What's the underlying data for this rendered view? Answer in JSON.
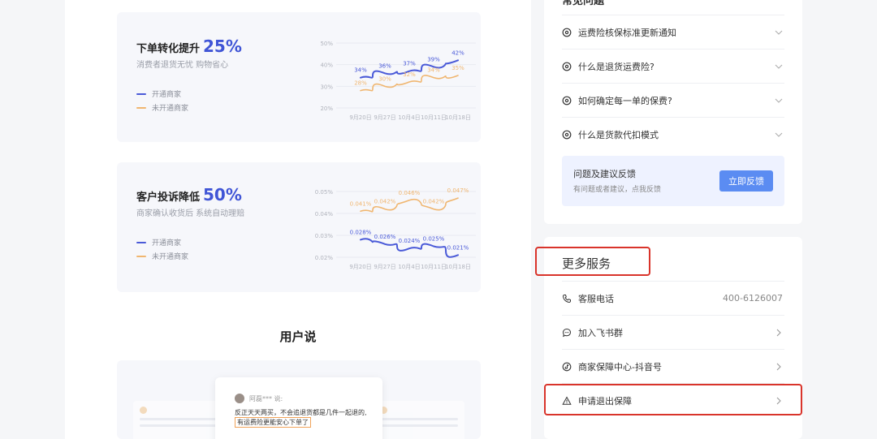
{
  "charts": [
    {
      "title": "下单转化提升",
      "pct": "25%",
      "subtitle": "消费者退货无忧 购物省心",
      "legend": [
        {
          "label": "开通商家",
          "color": "#4a5ad8"
        },
        {
          "label": "未开通商家",
          "color": "#f0b670"
        }
      ]
    },
    {
      "title": "客户投诉降低",
      "pct": "50%",
      "subtitle": "商家确认收货后 系统自动理赔",
      "legend": [
        {
          "label": "开通商家",
          "color": "#4a5ad8"
        },
        {
          "label": "未开通商家",
          "color": "#f0b670"
        }
      ]
    }
  ],
  "chart_data": [
    {
      "type": "line",
      "title": "下单转化提升 25%",
      "categories": [
        "9月20日",
        "9月27日",
        "10月4日",
        "10月11日",
        "10月18日"
      ],
      "yticks": [
        "50%",
        "40%",
        "30%",
        "20%"
      ],
      "ylim": [
        20,
        50
      ],
      "series": [
        {
          "name": "开通商家",
          "values": [
            34,
            36,
            37,
            39,
            42
          ],
          "labels": [
            "34%",
            "36%",
            "37%",
            "39%",
            "42%"
          ],
          "color": "#4a5ad8"
        },
        {
          "name": "未开通商家",
          "values": [
            28,
            30,
            32,
            34,
            35
          ],
          "labels": [
            "28%",
            "30%",
            "32%",
            "34%",
            "35%"
          ],
          "color": "#f0b670"
        }
      ]
    },
    {
      "type": "line",
      "title": "客户投诉降低 50%",
      "categories": [
        "9月20日",
        "9月27日",
        "10月4日",
        "10月11日",
        "10月18日"
      ],
      "yticks": [
        "0.05%",
        "0.04%",
        "0.03%",
        "0.02%"
      ],
      "ylim": [
        0.02,
        0.05
      ],
      "series": [
        {
          "name": "开通商家",
          "values": [
            0.028,
            0.026,
            0.024,
            0.025,
            0.021
          ],
          "labels": [
            "0.028%",
            "0.026%",
            "0.024%",
            "0.025%",
            "0.021%"
          ],
          "color": "#4a5ad8"
        },
        {
          "name": "未开通商家",
          "values": [
            0.041,
            0.042,
            0.046,
            0.042,
            0.047
          ],
          "labels": [
            "0.041%",
            "0.042%",
            "0.046%",
            "0.042%",
            "0.047%"
          ],
          "color": "#f0b670"
        }
      ]
    }
  ],
  "users": {
    "title": "用户说",
    "review_name": "阿磊*** 说:",
    "review_line1": "反正天天两买，不会追退货都是几件一起退的,",
    "review_line2": "有运费险更能安心下单了"
  },
  "faq": {
    "header": "常见问题",
    "items": [
      {
        "label": "运费险核保标准更新通知"
      },
      {
        "label": "什么是退货运费险?"
      },
      {
        "label": "如何确定每一单的保费?"
      },
      {
        "label": "什么是货款代扣模式"
      }
    ],
    "feedback_title": "问题及建议反馈",
    "feedback_sub": "有问题或者建议，点我反馈",
    "feedback_button": "立即反馈"
  },
  "services": {
    "header": "更多服务",
    "items": [
      {
        "label": "客服电话",
        "value": "400-6126007",
        "icon": "phone-icon"
      },
      {
        "label": "加入飞书群",
        "icon": "chat-icon"
      },
      {
        "label": "商家保障中心-抖音号",
        "icon": "douyin-icon"
      },
      {
        "label": "申请退出保障",
        "icon": "warning-icon"
      }
    ]
  }
}
